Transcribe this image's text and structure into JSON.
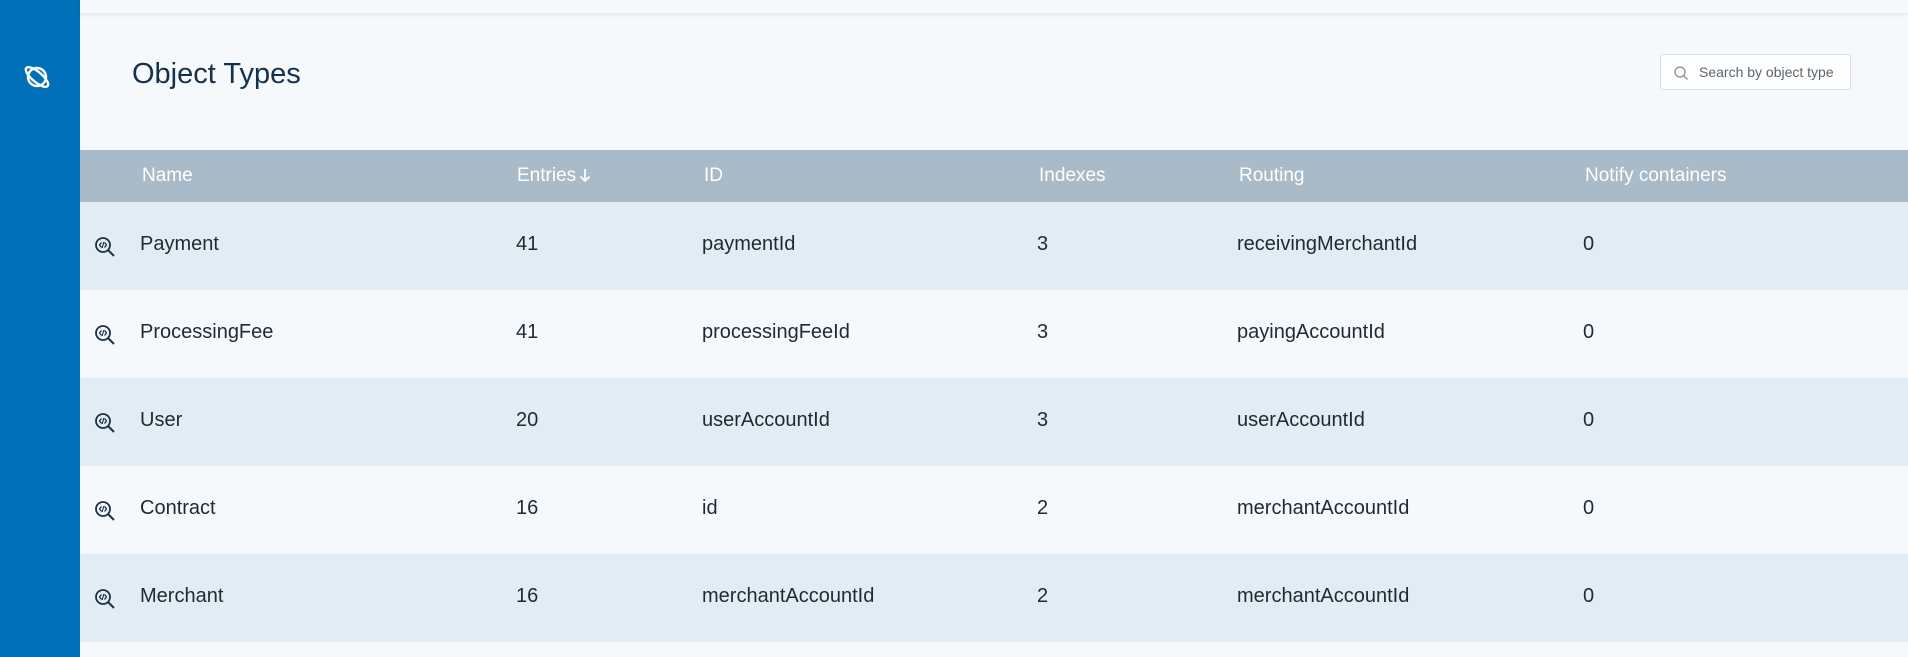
{
  "sidebar": {
    "logo_icon": "planet-icon",
    "color": "#0070b8"
  },
  "header": {
    "title": "Object Types",
    "search": {
      "placeholder": "Search by object type",
      "value": ""
    }
  },
  "table": {
    "columns": [
      "Name",
      "Entries",
      "ID",
      "Indexes",
      "Routing",
      "Notify containers"
    ],
    "sort": {
      "column": "Entries",
      "direction": "descending"
    },
    "rows": [
      {
        "name": "Payment",
        "entries": "41",
        "id": "paymentId",
        "indexes": "3",
        "routing": "receivingMerchantId",
        "notify": "0"
      },
      {
        "name": "ProcessingFee",
        "entries": "41",
        "id": "processingFeeId",
        "indexes": "3",
        "routing": "payingAccountId",
        "notify": "0"
      },
      {
        "name": "User",
        "entries": "20",
        "id": "userAccountId",
        "indexes": "3",
        "routing": "userAccountId",
        "notify": "0"
      },
      {
        "name": "Contract",
        "entries": "16",
        "id": "id",
        "indexes": "2",
        "routing": "merchantAccountId",
        "notify": "0"
      },
      {
        "name": "Merchant",
        "entries": "16",
        "id": "merchantAccountId",
        "indexes": "2",
        "routing": "merchantAccountId",
        "notify": "0"
      }
    ]
  }
}
